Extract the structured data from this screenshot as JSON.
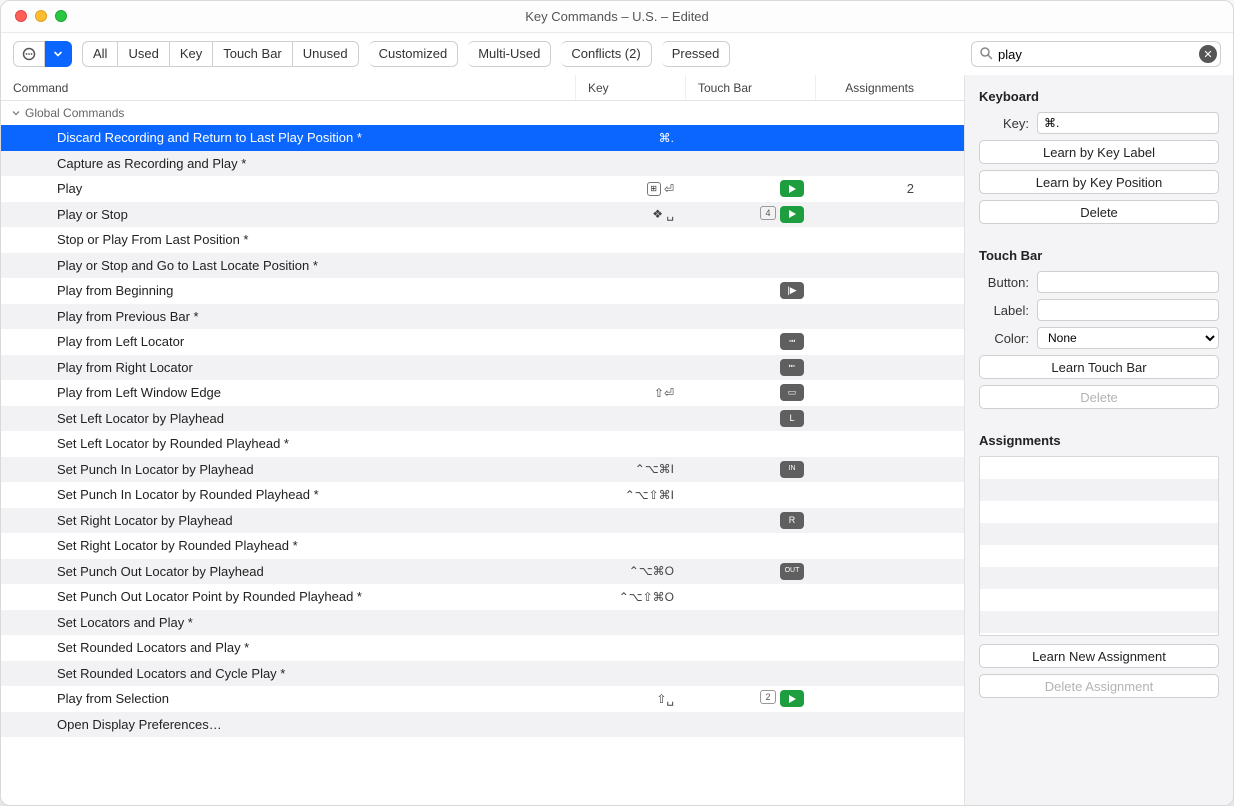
{
  "window": {
    "title": "Key Commands – U.S. – Edited"
  },
  "toolbar": {
    "filters": [
      "All",
      "Used",
      "Key",
      "Touch Bar",
      "Unused"
    ],
    "buttons": [
      "Customized",
      "Multi-Used",
      "Conflicts (2)",
      "Pressed"
    ]
  },
  "search": {
    "value": "play"
  },
  "columns": {
    "command": "Command",
    "key": "Key",
    "touchbar": "Touch Bar",
    "assignments": "Assignments"
  },
  "group": {
    "name": "Global Commands"
  },
  "rows": [
    {
      "cmd": "Discard Recording and Return to Last Play Position *",
      "key": "⌘.",
      "tb": "",
      "assign": "",
      "selected": true
    },
    {
      "cmd": "Capture as Recording and Play *",
      "key": "",
      "tb": "",
      "assign": ""
    },
    {
      "cmd": "Play",
      "key": "⏎",
      "keyIcon": "enter",
      "tb": "play-green",
      "assign": "2"
    },
    {
      "cmd": "Play or Stop",
      "key": "␣",
      "keyIcon": "stack",
      "tb": "play-green-4",
      "assign": ""
    },
    {
      "cmd": "Stop or Play From Last Position *",
      "key": "",
      "tb": "",
      "assign": ""
    },
    {
      "cmd": "Play or Stop and Go to Last Locate Position *",
      "key": "",
      "tb": "",
      "assign": ""
    },
    {
      "cmd": "Play from Beginning",
      "key": "",
      "tb": "play-start",
      "assign": ""
    },
    {
      "cmd": "Play from Previous Bar *",
      "key": "",
      "tb": "",
      "assign": ""
    },
    {
      "cmd": "Play from Left Locator",
      "key": "",
      "tb": "locator-l",
      "assign": ""
    },
    {
      "cmd": "Play from Right Locator",
      "key": "",
      "tb": "locator-r",
      "assign": ""
    },
    {
      "cmd": "Play from Left Window Edge",
      "key": "⇧⏎",
      "tb": "window-edge",
      "assign": ""
    },
    {
      "cmd": "Set Left Locator by Playhead",
      "key": "",
      "tb": "set-left",
      "assign": ""
    },
    {
      "cmd": "Set Left Locator by Rounded Playhead *",
      "key": "",
      "tb": "",
      "assign": ""
    },
    {
      "cmd": "Set Punch In Locator by Playhead",
      "key": "⌃⌥⌘I",
      "tb": "punch-in",
      "assign": ""
    },
    {
      "cmd": "Set Punch In Locator by Rounded Playhead *",
      "key": "⌃⌥⇧⌘I",
      "tb": "",
      "assign": ""
    },
    {
      "cmd": "Set Right Locator by Playhead",
      "key": "",
      "tb": "set-right",
      "assign": ""
    },
    {
      "cmd": "Set Right Locator by Rounded Playhead *",
      "key": "",
      "tb": "",
      "assign": ""
    },
    {
      "cmd": "Set Punch Out Locator by Playhead",
      "key": "⌃⌥⌘O",
      "tb": "punch-out",
      "assign": ""
    },
    {
      "cmd": "Set Punch Out Locator Point by Rounded Playhead *",
      "key": "⌃⌥⇧⌘O",
      "tb": "",
      "assign": ""
    },
    {
      "cmd": "Set Locators and Play *",
      "key": "",
      "tb": "",
      "assign": ""
    },
    {
      "cmd": "Set Rounded Locators and Play *",
      "key": "",
      "tb": "",
      "assign": ""
    },
    {
      "cmd": "Set Rounded Locators and Cycle Play *",
      "key": "",
      "tb": "",
      "assign": ""
    },
    {
      "cmd": "Play from Selection",
      "key": "⇧␣",
      "tb": "play-sel",
      "assign": ""
    },
    {
      "cmd": "Open Display Preferences…",
      "key": "",
      "tb": "",
      "assign": ""
    }
  ],
  "side": {
    "keyboard": {
      "heading": "Keyboard",
      "key_label": "Key:",
      "key_value": "⌘.",
      "learn_label": "Learn by Key Label",
      "learn_pos": "Learn by Key Position",
      "delete": "Delete"
    },
    "touchbar": {
      "heading": "Touch Bar",
      "button_label": "Button:",
      "label_label": "Label:",
      "color_label": "Color:",
      "color_value": "None",
      "learn": "Learn Touch Bar",
      "delete": "Delete"
    },
    "assignments": {
      "heading": "Assignments",
      "learn": "Learn New Assignment",
      "delete": "Delete Assignment"
    }
  }
}
